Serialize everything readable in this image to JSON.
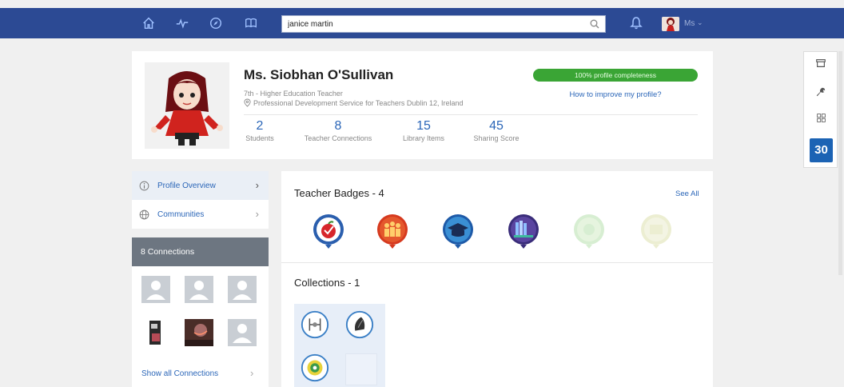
{
  "nav": {
    "icons": [
      "home-icon",
      "activity-icon",
      "compass-icon",
      "book-icon"
    ],
    "search_value": "janice martin",
    "user_label": "Ms"
  },
  "profile": {
    "name": "Ms. Siobhan O'Sullivan",
    "role": "7th - Higher Education Teacher",
    "org": "Professional Development Service for Teachers Dublin 12, Ireland",
    "completeness": "100% profile completeness",
    "improve_link": "How to improve my profile?",
    "stats": [
      {
        "num": "2",
        "label": "Students"
      },
      {
        "num": "8",
        "label": "Teacher Connections"
      },
      {
        "num": "15",
        "label": "Library Items"
      },
      {
        "num": "45",
        "label": "Sharing Score"
      }
    ]
  },
  "sidenav": {
    "items": [
      {
        "label": "Profile Overview"
      },
      {
        "label": "Communities"
      }
    ]
  },
  "connections": {
    "header": "8 Connections",
    "show_all": "Show all Connections"
  },
  "badges": {
    "title": "Teacher Badges - 4",
    "see_all": "See All"
  },
  "collections": {
    "title": "Collections - 1"
  },
  "widget": {
    "calendar_day": "30"
  },
  "colors": {
    "nav_bg": "#2c4a94",
    "link": "#2b66b8",
    "completeness": "#3aa535",
    "connections_header": "#6d7681",
    "calendar": "#1c63b4"
  }
}
